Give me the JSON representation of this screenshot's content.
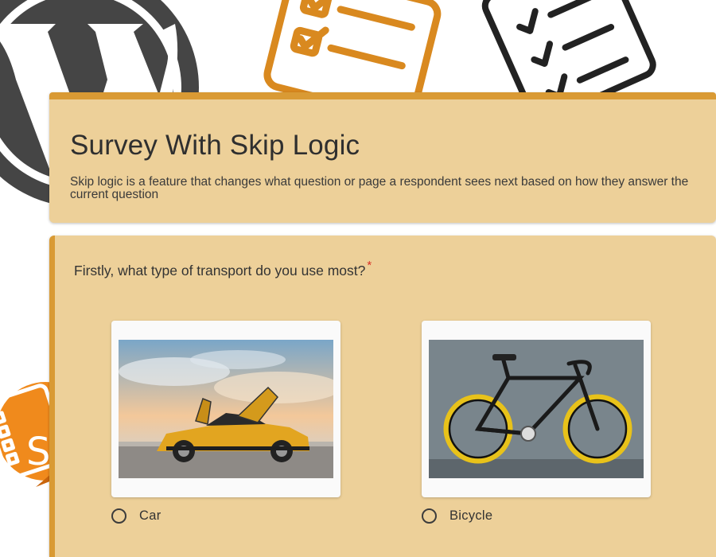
{
  "survey": {
    "title": "Survey With Skip Logic",
    "description": "Skip logic is a feature that changes what question or page a respondent sees next based on how they answer the current question"
  },
  "question": {
    "text": "Firstly, what type of transport do you use most?",
    "required_mark": "*",
    "options": [
      {
        "label": "Car",
        "image": "car-image"
      },
      {
        "label": "Bicycle",
        "image": "bicycle-image"
      }
    ]
  },
  "colors": {
    "card_bg": "#edd099",
    "accent": "#d99a34",
    "required": "#d93025"
  },
  "icons": [
    "wordpress-logo-icon",
    "survey-document-icon",
    "clipboard-checklist-icon",
    "survey-plugin-badge-icon",
    "radio-unchecked-icon"
  ]
}
